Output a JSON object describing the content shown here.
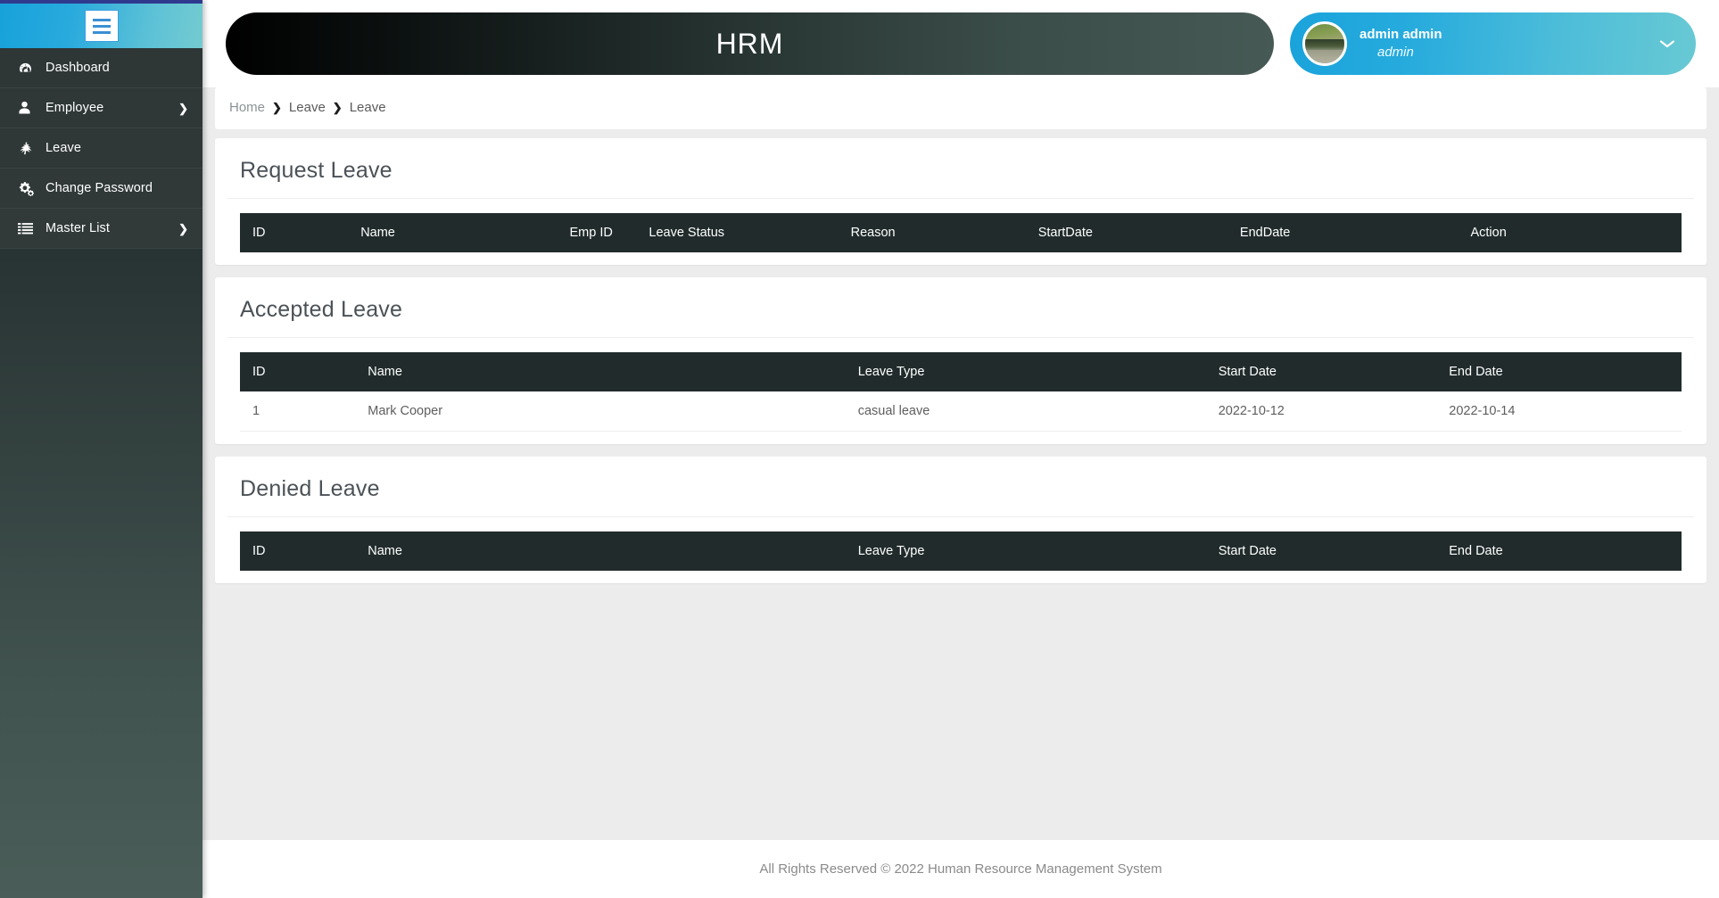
{
  "sidebar": {
    "toggle_icon": "hamburger-icon",
    "items": [
      {
        "label": "Dashboard",
        "icon": "dashboard-icon",
        "has_arrow": false
      },
      {
        "label": "Employee",
        "icon": "user-icon",
        "has_arrow": true,
        "arrow": "❯"
      },
      {
        "label": "Leave",
        "icon": "leave-icon",
        "has_arrow": false
      },
      {
        "label": "Change Password",
        "icon": "gears-icon",
        "has_arrow": false
      },
      {
        "label": "Master List",
        "icon": "list-icon",
        "has_arrow": true,
        "arrow": "❯"
      }
    ]
  },
  "header": {
    "brand_title": "HRM",
    "user": {
      "name": "admin admin",
      "role": "admin",
      "avatar_icon": "avatar",
      "caret_icon": "chevron-down-icon",
      "caret": "⌄"
    }
  },
  "breadcrumb": {
    "home": "Home",
    "separator": "❯",
    "items": [
      "Leave",
      "Leave"
    ]
  },
  "sections": {
    "request_leave": {
      "title": "Request Leave",
      "columns": [
        "ID",
        "Name",
        "Emp ID",
        "Leave Status",
        "Reason",
        "StartDate",
        "EndDate",
        "Action"
      ],
      "rows": []
    },
    "accepted_leave": {
      "title": "Accepted Leave",
      "columns": [
        "ID",
        "Name",
        "Leave Type",
        "Start Date",
        "End Date"
      ],
      "rows": [
        [
          "1",
          "Mark Cooper",
          "casual leave",
          "2022-10-12",
          "2022-10-14"
        ]
      ]
    },
    "denied_leave": {
      "title": "Denied Leave",
      "columns": [
        "ID",
        "Name",
        "Leave Type",
        "Start Date",
        "End Date"
      ],
      "rows": []
    }
  },
  "footer": {
    "text": "All Rights Reserved © 2022 Human Resource Management System"
  },
  "colors": {
    "accent_blue": "#1aa3db",
    "accent_teal": "#68c9d3",
    "table_header": "#212b2b",
    "page_bg": "#ececec",
    "sidebar_menu": "#2e3636"
  }
}
